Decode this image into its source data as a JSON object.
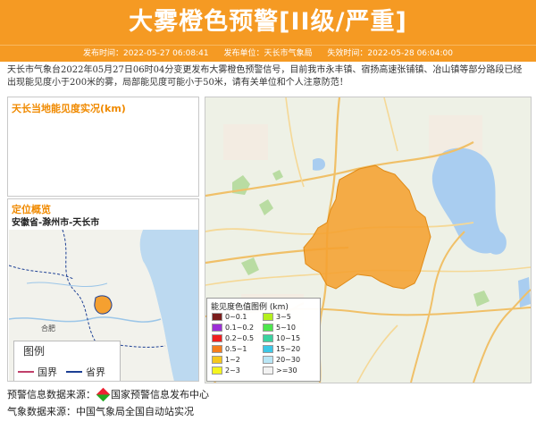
{
  "header": {
    "title": "大雾橙色预警[II级/严重]"
  },
  "infobar": {
    "publish_time_label": "发布时间：",
    "publish_time": "2022-05-27 06:08:41",
    "publisher_label": "发布单位：",
    "publisher": "天长市气象局",
    "expire_label": "失效时间：",
    "expire_time": "2022-05-28 06:04:00"
  },
  "description": "天长市气象台2022年05月27日06时04分变更发布大雾橙色预警信号，目前我市永丰镇、宿扬高速张铺镇、冶山镇等部分路段已经出现能见度小于200米的雾，局部能见度可能小于50米，请有关单位和个人注意防范！",
  "visibility_panel": {
    "title": "天长当地能见度实况(km)"
  },
  "location_panel": {
    "title": "定位概览",
    "region": "安徽省-滁州市-天长市",
    "map_labels": {
      "hefei": "合肥"
    },
    "legend": {
      "title": "图例",
      "items": [
        {
          "label": "国界",
          "color": "#c0406a"
        },
        {
          "label": "省界",
          "color": "#1c3f94"
        }
      ]
    }
  },
  "map": {
    "legend_title": "能见度色值图例 (km)",
    "legend_items": [
      {
        "label": "0~0.1",
        "color": "#7a1d1d"
      },
      {
        "label": "0.1~0.2",
        "color": "#9b2fd6"
      },
      {
        "label": "0.2~0.5",
        "color": "#f01e1e"
      },
      {
        "label": "0.5~1",
        "color": "#f57d1e"
      },
      {
        "label": "1~2",
        "color": "#f5c81e"
      },
      {
        "label": "2~3",
        "color": "#f5f51e"
      },
      {
        "label": "3~5",
        "color": "#b4f01e"
      },
      {
        "label": "5~10",
        "color": "#4ee64e"
      },
      {
        "label": "10~15",
        "color": "#3cd2a0"
      },
      {
        "label": "15~20",
        "color": "#3cc8e6"
      },
      {
        "label": "20~30",
        "color": "#b9e6f5"
      },
      {
        "label": ">=30",
        "color": "#f2f2f2"
      }
    ],
    "warning_color": "#f5a030"
  },
  "sources": {
    "warning_label": "预警信息数据来源：",
    "warning_source": "国家预警信息发布中心",
    "weather_label": "气象数据来源：",
    "weather_source": "中国气象局全国自动站实况"
  }
}
